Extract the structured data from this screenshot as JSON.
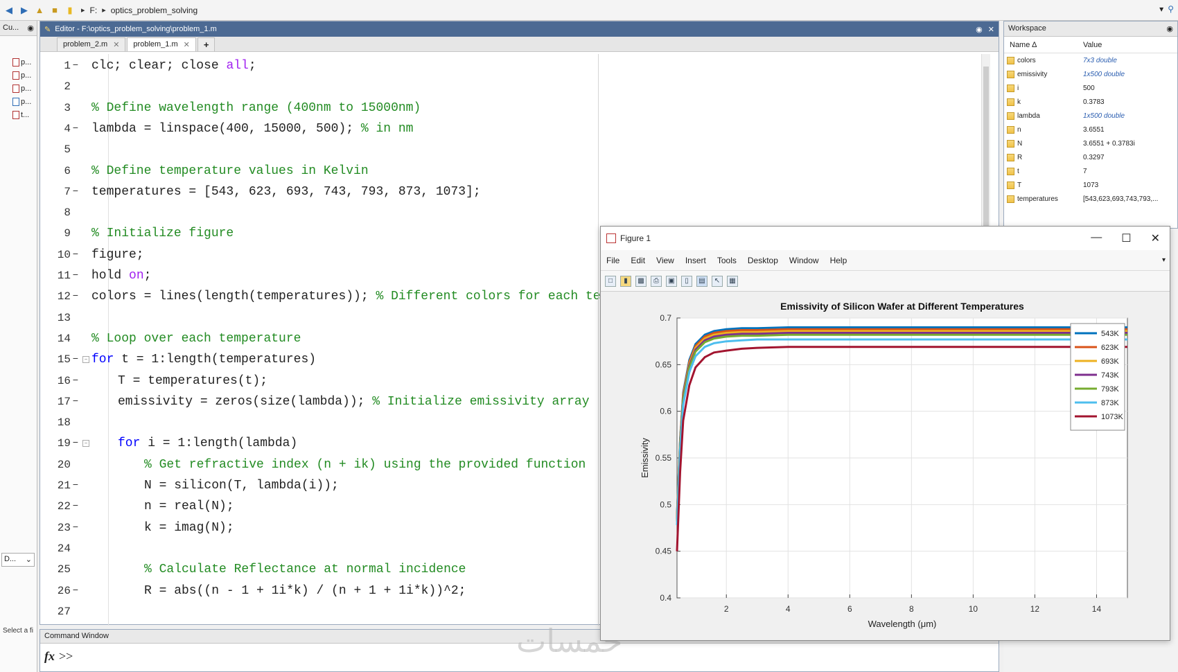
{
  "address": {
    "drive": "F:",
    "folder": "optics_problem_solving"
  },
  "left_panel": {
    "header": "Cu...",
    "files": [
      "p...",
      "p...",
      "p...",
      "p...",
      "t..."
    ],
    "combo": "D...",
    "status": "Select a fi"
  },
  "editor": {
    "title": "Editor - F:\\optics_problem_solving\\problem_1.m",
    "tabs": [
      {
        "label": "problem_2.m",
        "active": false
      },
      {
        "label": "problem_1.m",
        "active": true
      }
    ],
    "add_tab": "+"
  },
  "code_lines": [
    {
      "n": "1",
      "dash": true,
      "indent": 0,
      "parts": [
        [
          "t",
          "clc; clear; close "
        ],
        [
          "s",
          "all"
        ],
        [
          "t",
          ";"
        ]
      ]
    },
    {
      "n": "2",
      "dash": false,
      "indent": 0,
      "parts": []
    },
    {
      "n": "3",
      "dash": false,
      "indent": 0,
      "parts": [
        [
          "c",
          "% Define wavelength range (400nm to 15000nm)"
        ]
      ]
    },
    {
      "n": "4",
      "dash": true,
      "indent": 0,
      "parts": [
        [
          "t",
          "lambda = linspace(400, 15000, 500); "
        ],
        [
          "c",
          "% in nm"
        ]
      ]
    },
    {
      "n": "5",
      "dash": false,
      "indent": 0,
      "parts": []
    },
    {
      "n": "6",
      "dash": false,
      "indent": 0,
      "parts": [
        [
          "c",
          "% Define temperature values in Kelvin"
        ]
      ]
    },
    {
      "n": "7",
      "dash": true,
      "indent": 0,
      "parts": [
        [
          "t",
          "temperatures = [543, 623, 693, 743, 793, 873, 1073];"
        ]
      ]
    },
    {
      "n": "8",
      "dash": false,
      "indent": 0,
      "parts": []
    },
    {
      "n": "9",
      "dash": false,
      "indent": 0,
      "parts": [
        [
          "c",
          "% Initialize figure"
        ]
      ]
    },
    {
      "n": "10",
      "dash": true,
      "indent": 0,
      "parts": [
        [
          "t",
          "figure;"
        ]
      ]
    },
    {
      "n": "11",
      "dash": true,
      "indent": 0,
      "parts": [
        [
          "t",
          "hold "
        ],
        [
          "s",
          "on"
        ],
        [
          "t",
          ";"
        ]
      ]
    },
    {
      "n": "12",
      "dash": true,
      "indent": 0,
      "parts": [
        [
          "t",
          "colors = lines(length(temperatures)); "
        ],
        [
          "c",
          "% Different colors for each temp"
        ]
      ]
    },
    {
      "n": "13",
      "dash": false,
      "indent": 0,
      "parts": []
    },
    {
      "n": "14",
      "dash": false,
      "indent": 0,
      "parts": [
        [
          "c",
          "% Loop over each temperature"
        ]
      ]
    },
    {
      "n": "15",
      "dash": true,
      "fold": true,
      "indent": 0,
      "parts": [
        [
          "k",
          "for"
        ],
        [
          "t",
          " t = 1:length(temperatures)"
        ]
      ]
    },
    {
      "n": "16",
      "dash": true,
      "indent": 1,
      "parts": [
        [
          "t",
          "T = temperatures(t);"
        ]
      ]
    },
    {
      "n": "17",
      "dash": true,
      "indent": 1,
      "parts": [
        [
          "t",
          "emissivity = zeros(size(lambda)); "
        ],
        [
          "c",
          "% Initialize emissivity array"
        ]
      ]
    },
    {
      "n": "18",
      "dash": false,
      "indent": 0,
      "parts": []
    },
    {
      "n": "19",
      "dash": true,
      "fold": true,
      "indent": 1,
      "parts": [
        [
          "k",
          "for"
        ],
        [
          "t",
          " i = 1:length(lambda)"
        ]
      ]
    },
    {
      "n": "20",
      "dash": false,
      "indent": 2,
      "parts": [
        [
          "c",
          "% Get refractive index (n + ik) using the provided function"
        ]
      ]
    },
    {
      "n": "21",
      "dash": true,
      "indent": 2,
      "parts": [
        [
          "t",
          "N = silicon(T, lambda(i));"
        ]
      ]
    },
    {
      "n": "22",
      "dash": true,
      "indent": 2,
      "parts": [
        [
          "t",
          "n = real(N);"
        ]
      ]
    },
    {
      "n": "23",
      "dash": true,
      "indent": 2,
      "parts": [
        [
          "t",
          "k = imag(N);"
        ]
      ]
    },
    {
      "n": "24",
      "dash": false,
      "indent": 0,
      "parts": []
    },
    {
      "n": "25",
      "dash": false,
      "indent": 2,
      "parts": [
        [
          "c",
          "% Calculate Reflectance at normal incidence"
        ]
      ]
    },
    {
      "n": "26",
      "dash": true,
      "indent": 2,
      "parts": [
        [
          "t",
          "R = abs((n - 1 + 1i*k) / (n + 1 + 1i*k))^2;"
        ]
      ]
    },
    {
      "n": "27",
      "dash": false,
      "indent": 0,
      "parts": []
    }
  ],
  "workspace": {
    "title": "Workspace",
    "col_name": "Name ∆",
    "col_value": "Value",
    "rows": [
      {
        "name": "colors",
        "value": "7x3 double",
        "link": true
      },
      {
        "name": "emissivity",
        "value": "1x500 double",
        "link": true
      },
      {
        "name": "i",
        "value": "500",
        "link": false
      },
      {
        "name": "k",
        "value": "0.3783",
        "link": false
      },
      {
        "name": "lambda",
        "value": "1x500 double",
        "link": true
      },
      {
        "name": "n",
        "value": "3.6551",
        "link": false
      },
      {
        "name": "N",
        "value": "3.6551 + 0.3783i",
        "link": false
      },
      {
        "name": "R",
        "value": "0.3297",
        "link": false
      },
      {
        "name": "t",
        "value": "7",
        "link": false
      },
      {
        "name": "T",
        "value": "1073",
        "link": false
      },
      {
        "name": "temperatures",
        "value": "[543,623,693,743,793,...",
        "link": false
      }
    ]
  },
  "command_window": {
    "title": "Command Window",
    "fx": "fx",
    "prompt": ">>"
  },
  "figure_window": {
    "title": "Figure 1",
    "menu": [
      "File",
      "Edit",
      "View",
      "Insert",
      "Tools",
      "Desktop",
      "Window",
      "Help"
    ]
  },
  "chart_data": {
    "type": "line",
    "title": "Emissivity of Silicon Wafer at Different Temperatures",
    "xlabel": "Wavelength (μm)",
    "ylabel": "Emissivity",
    "xlim": [
      0.4,
      15
    ],
    "ylim": [
      0.4,
      0.7
    ],
    "xticks": [
      2,
      4,
      6,
      8,
      10,
      12,
      14
    ],
    "yticks": [
      0.4,
      0.45,
      0.5,
      0.55,
      0.6,
      0.65,
      0.7
    ],
    "grid": true,
    "legend_position": "top-right",
    "x": [
      0.4,
      0.5,
      0.6,
      0.8,
      1.0,
      1.3,
      1.6,
      2,
      2.5,
      3,
      4,
      5,
      6,
      8,
      10,
      12,
      14,
      15
    ],
    "series": [
      {
        "name": "543K",
        "color": "#0072bd",
        "values": [
          0.49,
          0.57,
          0.62,
          0.655,
          0.672,
          0.682,
          0.686,
          0.688,
          0.689,
          0.689,
          0.69,
          0.69,
          0.69,
          0.69,
          0.69,
          0.69,
          0.69,
          0.69
        ]
      },
      {
        "name": "623K",
        "color": "#d95319",
        "values": [
          0.488,
          0.568,
          0.618,
          0.653,
          0.67,
          0.68,
          0.684,
          0.686,
          0.687,
          0.687,
          0.688,
          0.688,
          0.688,
          0.688,
          0.688,
          0.688,
          0.688,
          0.688
        ]
      },
      {
        "name": "693K",
        "color": "#edb120",
        "values": [
          0.486,
          0.566,
          0.616,
          0.651,
          0.668,
          0.678,
          0.682,
          0.684,
          0.685,
          0.685,
          0.686,
          0.686,
          0.686,
          0.686,
          0.686,
          0.686,
          0.686,
          0.686
        ]
      },
      {
        "name": "743K",
        "color": "#7e2f8e",
        "values": [
          0.484,
          0.564,
          0.614,
          0.649,
          0.666,
          0.676,
          0.68,
          0.682,
          0.683,
          0.683,
          0.684,
          0.684,
          0.684,
          0.684,
          0.684,
          0.684,
          0.684,
          0.684
        ]
      },
      {
        "name": "793K",
        "color": "#77ac30",
        "values": [
          0.482,
          0.562,
          0.612,
          0.647,
          0.664,
          0.674,
          0.678,
          0.68,
          0.681,
          0.681,
          0.682,
          0.682,
          0.682,
          0.682,
          0.682,
          0.682,
          0.682,
          0.682
        ]
      },
      {
        "name": "873K",
        "color": "#4dbeee",
        "values": [
          0.478,
          0.558,
          0.607,
          0.642,
          0.659,
          0.669,
          0.673,
          0.675,
          0.676,
          0.677,
          0.677,
          0.677,
          0.677,
          0.677,
          0.677,
          0.677,
          0.677,
          0.677
        ]
      },
      {
        "name": "1073K",
        "color": "#a2142f",
        "values": [
          0.45,
          0.535,
          0.59,
          0.628,
          0.647,
          0.658,
          0.663,
          0.665,
          0.667,
          0.668,
          0.669,
          0.669,
          0.669,
          0.669,
          0.669,
          0.669,
          0.669,
          0.669
        ]
      }
    ]
  },
  "watermark": "خمسات"
}
